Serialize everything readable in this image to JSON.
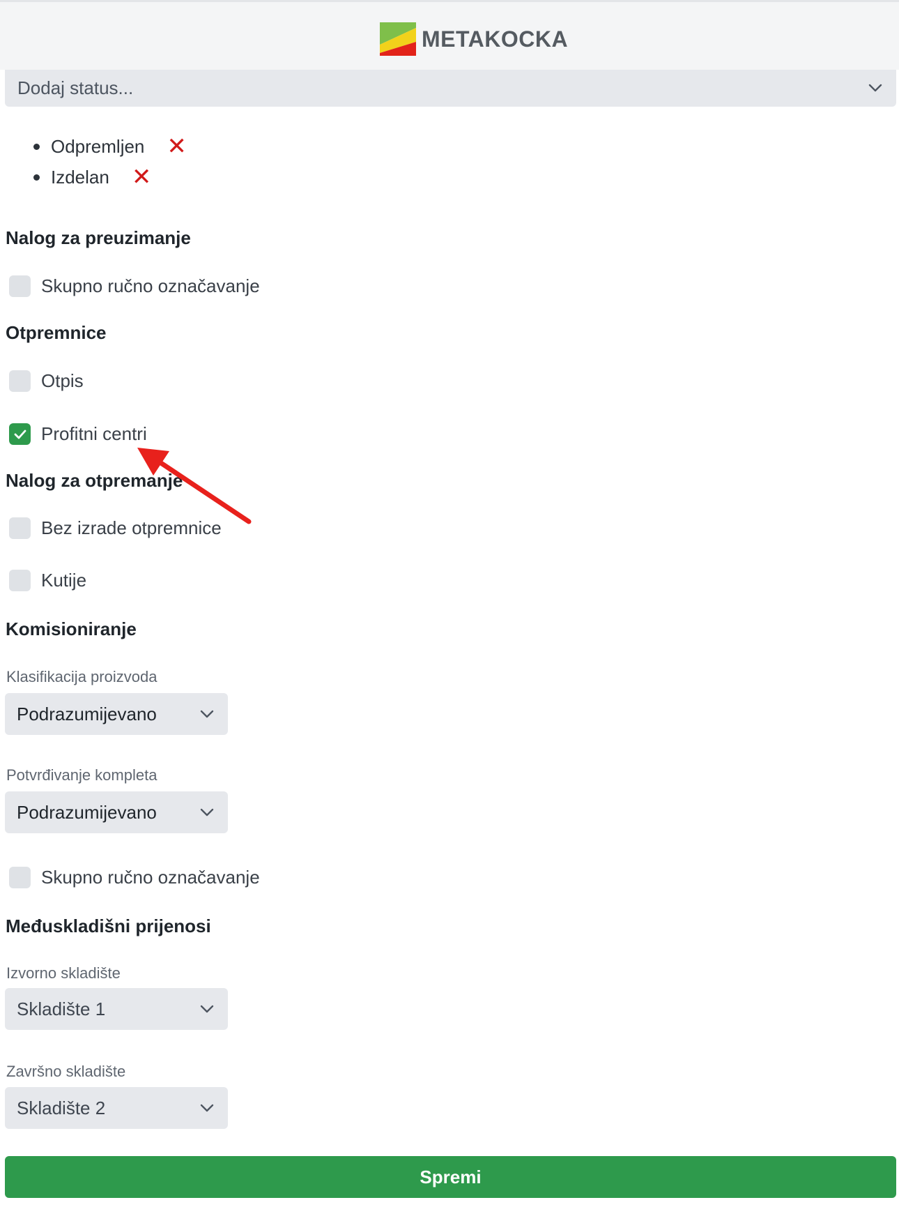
{
  "header": {
    "brand": "METAKOCKA",
    "logo_icon": "metakocka-logo-icon"
  },
  "status_select": {
    "placeholder": "Dodaj status...",
    "icon": "chevron-down-icon"
  },
  "statuses": [
    {
      "label": "Odpremljen",
      "remove_icon": "close-icon"
    },
    {
      "label": "Izdelan",
      "remove_icon": "close-icon"
    }
  ],
  "sections": {
    "preuzimanje": {
      "title": "Nalog za preuzimanje",
      "skupno": {
        "label": "Skupno ručno označavanje",
        "checked": false
      }
    },
    "otpremnice": {
      "title": "Otpremnice",
      "otpis": {
        "label": "Otpis",
        "checked": false
      },
      "profitni": {
        "label": "Profitni centri",
        "checked": true
      }
    },
    "otpremanje": {
      "title": "Nalog za otpremanje",
      "bez_izrade": {
        "label": "Bez izrade otpremnice",
        "checked": false
      },
      "kutije": {
        "label": "Kutije",
        "checked": false
      }
    },
    "komisioniranje": {
      "title": "Komisioniranje",
      "klasifikacija": {
        "label": "Klasifikacija proizvoda",
        "value": "Podrazumijevano"
      },
      "potvrdivanje": {
        "label": "Potvrđivanje kompleta",
        "value": "Podrazumijevano"
      },
      "skupno": {
        "label": "Skupno ručno označavanje",
        "checked": false
      }
    },
    "prijenosi": {
      "title": "Međuskladišni prijenosi",
      "izvorno": {
        "label": "Izvorno skladište",
        "value": "Skladište 1"
      },
      "zavrsno": {
        "label": "Završno skladište",
        "value": "Skladište 2"
      }
    }
  },
  "save_label": "Spremi",
  "colors": {
    "accent_green": "#2e9a4c",
    "remove_red": "#d11a1a",
    "annotation_arrow": "#e8211c"
  }
}
